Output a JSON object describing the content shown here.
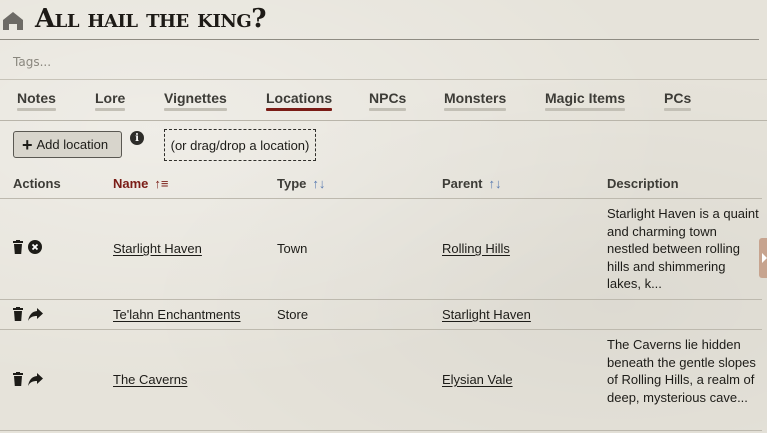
{
  "header": {
    "title": "All hail the king?",
    "home_icon": "home-icon"
  },
  "tags": {
    "placeholder": "Tags..."
  },
  "tabs": [
    {
      "label": "Notes"
    },
    {
      "label": "Lore"
    },
    {
      "label": "Vignettes"
    },
    {
      "label": "Locations",
      "active": true
    },
    {
      "label": "NPCs"
    },
    {
      "label": "Monsters"
    },
    {
      "label": "Magic Items"
    },
    {
      "label": "PCs"
    }
  ],
  "toolbar": {
    "add_label": "Add location",
    "drop_label": "(or drag/drop a location)"
  },
  "table": {
    "columns": {
      "actions": "Actions",
      "name": "Name",
      "type": "Type",
      "parent": "Parent",
      "description": "Description"
    },
    "rows": [
      {
        "actions": [
          "trash-icon",
          "remove-circle-icon"
        ],
        "name": "Starlight Haven",
        "type": "Town",
        "parent": "Rolling Hills",
        "description": "Starlight Haven is a quaint and charming town nestled between rolling hills and shimmering lakes, k..."
      },
      {
        "actions": [
          "trash-icon",
          "share-arrow-icon"
        ],
        "name": "Te'lahn Enchantments",
        "type": "Store",
        "parent": "Starlight Haven",
        "description": ""
      },
      {
        "actions": [
          "trash-icon",
          "share-arrow-icon"
        ],
        "name": "The Caverns",
        "type": "",
        "parent": "Elysian Vale",
        "description": "The Caverns lie hidden beneath the gentle slopes of Rolling Hills, a realm of deep, mysterious cave..."
      }
    ]
  },
  "colors": {
    "accent": "#7a1c16",
    "sort_icon": "#5a7bb0",
    "text": "#191813"
  }
}
